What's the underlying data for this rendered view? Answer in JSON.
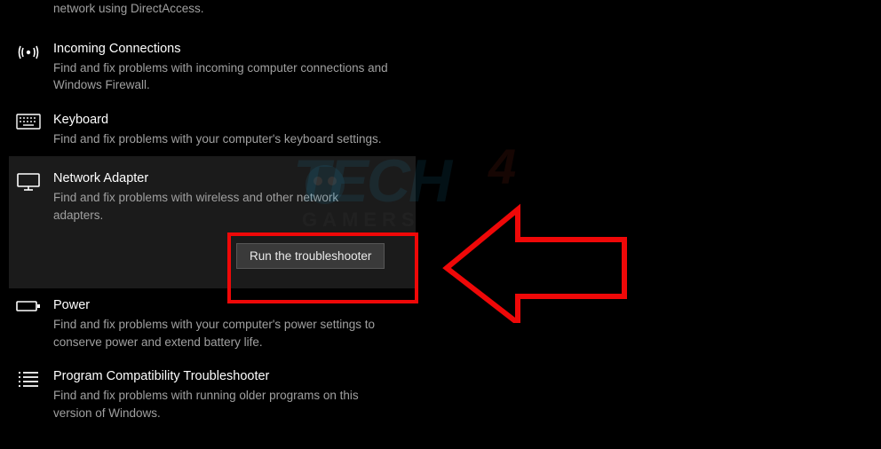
{
  "items": [
    {
      "title": "",
      "desc": "network using DirectAccess.",
      "icon": ""
    },
    {
      "title": "Incoming Connections",
      "desc": "Find and fix problems with incoming computer connections and Windows Firewall.",
      "icon": "signal-icon"
    },
    {
      "title": "Keyboard",
      "desc": "Find and fix problems with your computer's keyboard settings.",
      "icon": "keyboard-icon"
    },
    {
      "title": "Network Adapter",
      "desc": "Find and fix problems with wireless and other network adapters.",
      "icon": "monitor-icon",
      "selected": true,
      "run_label": "Run the troubleshooter"
    },
    {
      "title": "Power",
      "desc": "Find and fix problems with your computer's power settings to conserve power and extend battery life.",
      "icon": "battery-icon"
    },
    {
      "title": "Program Compatibility Troubleshooter",
      "desc": "Find and fix problems with running older programs on this version of Windows.",
      "icon": "list-icon"
    }
  ],
  "watermark": {
    "brand_left": "TECH",
    "brand_right": "4",
    "sub": "GAMERS"
  },
  "annotation": {
    "box": true,
    "arrow": true
  }
}
